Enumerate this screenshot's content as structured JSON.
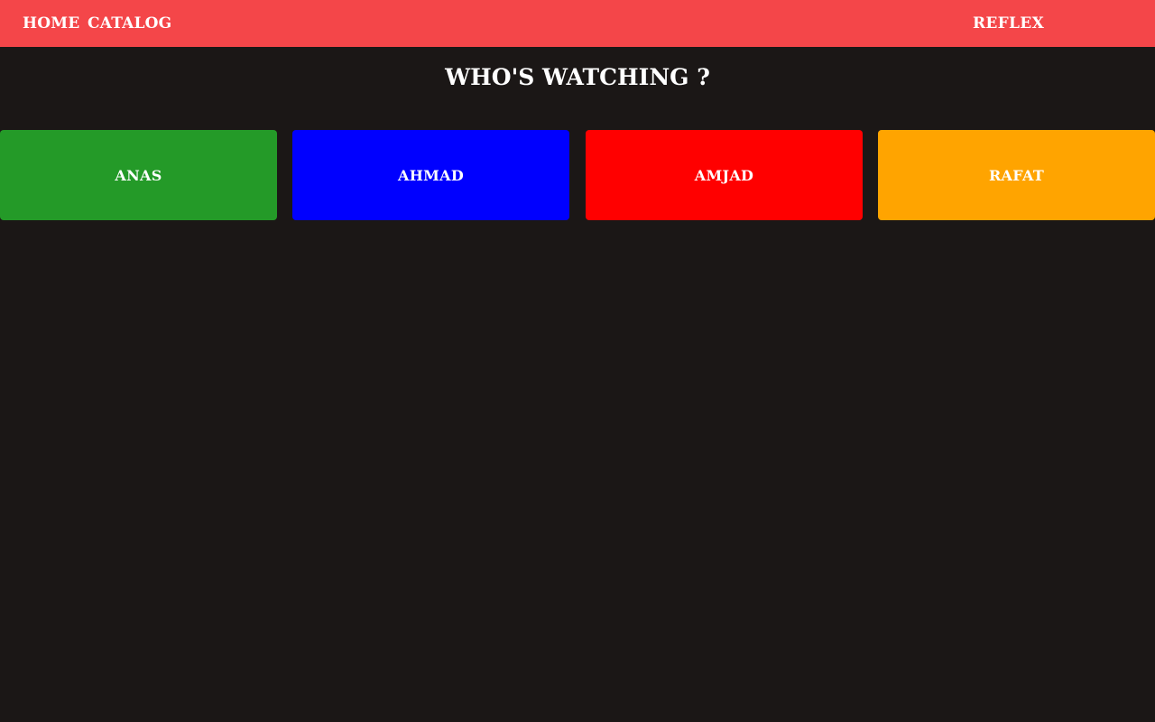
{
  "navbar": {
    "color": "#f44649",
    "links": [
      {
        "label": "Home"
      },
      {
        "label": "Catalog"
      }
    ],
    "brand": "Reflex"
  },
  "page": {
    "title": "Who's Watching ?",
    "background": "#1b1716"
  },
  "profiles": [
    {
      "name": "Anas",
      "color": "#249a28"
    },
    {
      "name": "Ahmad",
      "color": "#0000ff"
    },
    {
      "name": "Amjad",
      "color": "#ff0000"
    },
    {
      "name": "Rafat",
      "color": "#ffa400"
    }
  ]
}
